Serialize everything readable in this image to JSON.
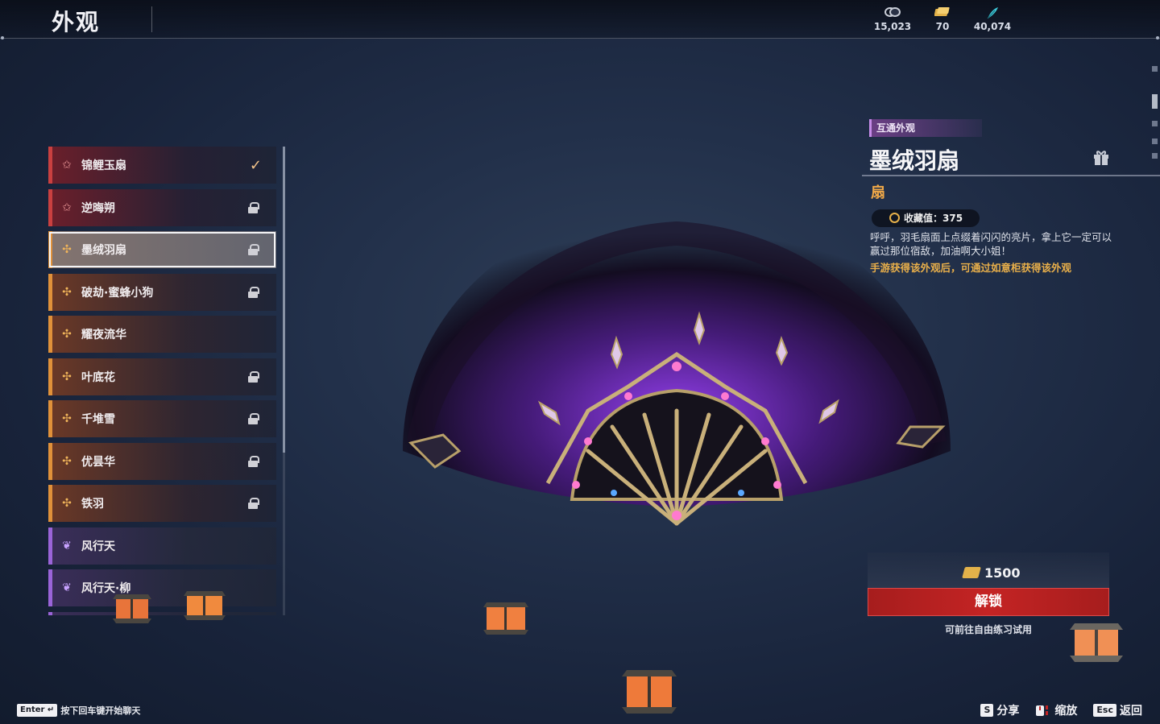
{
  "header": {
    "title": "外观",
    "currencies": [
      {
        "icon": "coin-icon",
        "value": "15,023"
      },
      {
        "icon": "ticket-icon",
        "value": "70"
      },
      {
        "icon": "feather-icon",
        "value": "40,074"
      }
    ]
  },
  "list": {
    "items": [
      {
        "name": "锦鲤玉扇",
        "rarity": "red",
        "status": "equipped"
      },
      {
        "name": "逆晦朔",
        "rarity": "red",
        "status": "locked"
      },
      {
        "name": "墨绒羽扇",
        "rarity": "orange",
        "status": "locked",
        "selected": true
      },
      {
        "name": "破劫·蜜蜂小狗",
        "rarity": "orange",
        "status": "locked"
      },
      {
        "name": "耀夜流华",
        "rarity": "orange",
        "status": "unlocked"
      },
      {
        "name": "叶底花",
        "rarity": "orange",
        "status": "locked"
      },
      {
        "name": "千堆雪",
        "rarity": "orange",
        "status": "locked"
      },
      {
        "name": "优昙华",
        "rarity": "orange",
        "status": "locked"
      },
      {
        "name": "铁羽",
        "rarity": "orange",
        "status": "locked"
      },
      {
        "name": "风行天",
        "rarity": "purple",
        "status": "unlocked"
      },
      {
        "name": "风行天·柳",
        "rarity": "purple",
        "status": "unlocked"
      }
    ]
  },
  "detail": {
    "tag": "互通外观",
    "title": "墨绒羽扇",
    "type": "扇",
    "collect_label": "收藏值：375",
    "description": "呼呼，羽毛扇面上点缀着闪闪的亮片，拿上它一定可以赢过那位宿敌，加油啊大小姐！",
    "hint": "手游获得该外观后，可通过如意柜获得该外观",
    "price": "1500",
    "unlock_label": "解锁",
    "try_label": "可前往自由练习试用"
  },
  "footer": {
    "chat_key": "Enter",
    "chat_hint": "按下回车键开始聊天",
    "actions": [
      {
        "key": "S",
        "label": "分享"
      },
      {
        "key": "",
        "label": "缩放"
      },
      {
        "key": "Esc",
        "label": "返回"
      }
    ]
  },
  "colors": {
    "red_rarity": "#c94040",
    "orange_rarity": "#e0913a",
    "purple_rarity": "#9a64d8",
    "unlock_button": "#c42424",
    "hint_text": "#eab04a"
  }
}
